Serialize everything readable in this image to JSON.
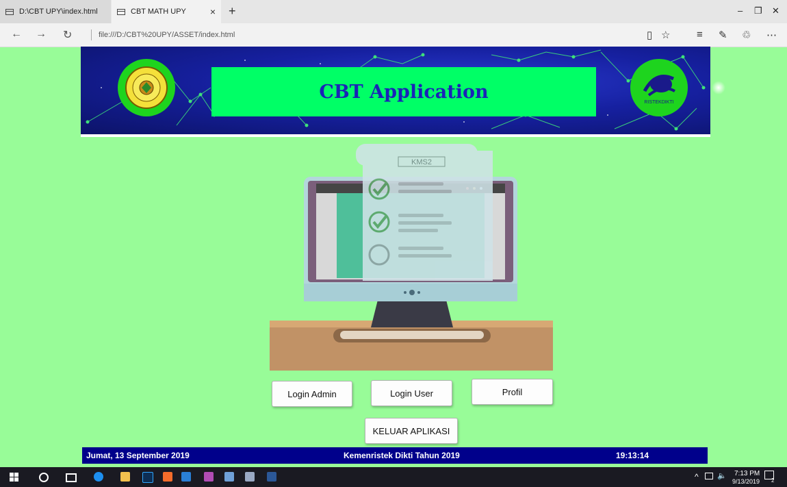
{
  "browser": {
    "tabs": [
      {
        "label": "D:\\CBT UPY\\index.html"
      },
      {
        "label": "CBT MATH UPY"
      }
    ],
    "new_tab": "+",
    "tab_close": "×",
    "url": "file:///D:/CBT%20UPY/ASSET/index.html",
    "window_controls": {
      "minimize": "–",
      "restore": "❐",
      "close": "✕"
    }
  },
  "header": {
    "title": "CBT Application",
    "right_logo_text": "RISTEKDIKTI"
  },
  "illustration": {
    "paper_label": "KMS2"
  },
  "buttons": {
    "login_admin": "Login Admin",
    "login_user": "Login User",
    "profil": "Profil",
    "keluar": "KELUAR APLIKASI"
  },
  "footer": {
    "date": "Jumat, 13 September 2019",
    "center": "Kemenristek Dikti Tahun 2019",
    "time": "19:13:14"
  },
  "taskbar": {
    "clock_time": "7:13 PM",
    "clock_date": "9/13/2019",
    "notifications": "2"
  },
  "colors": {
    "page_bg": "#98fc98",
    "banner_bg": "#1620a0",
    "title_box": "#00ff66",
    "title_text": "#1a23b8",
    "logo_circle": "#1ed41e",
    "footer_bg": "#00008b"
  }
}
